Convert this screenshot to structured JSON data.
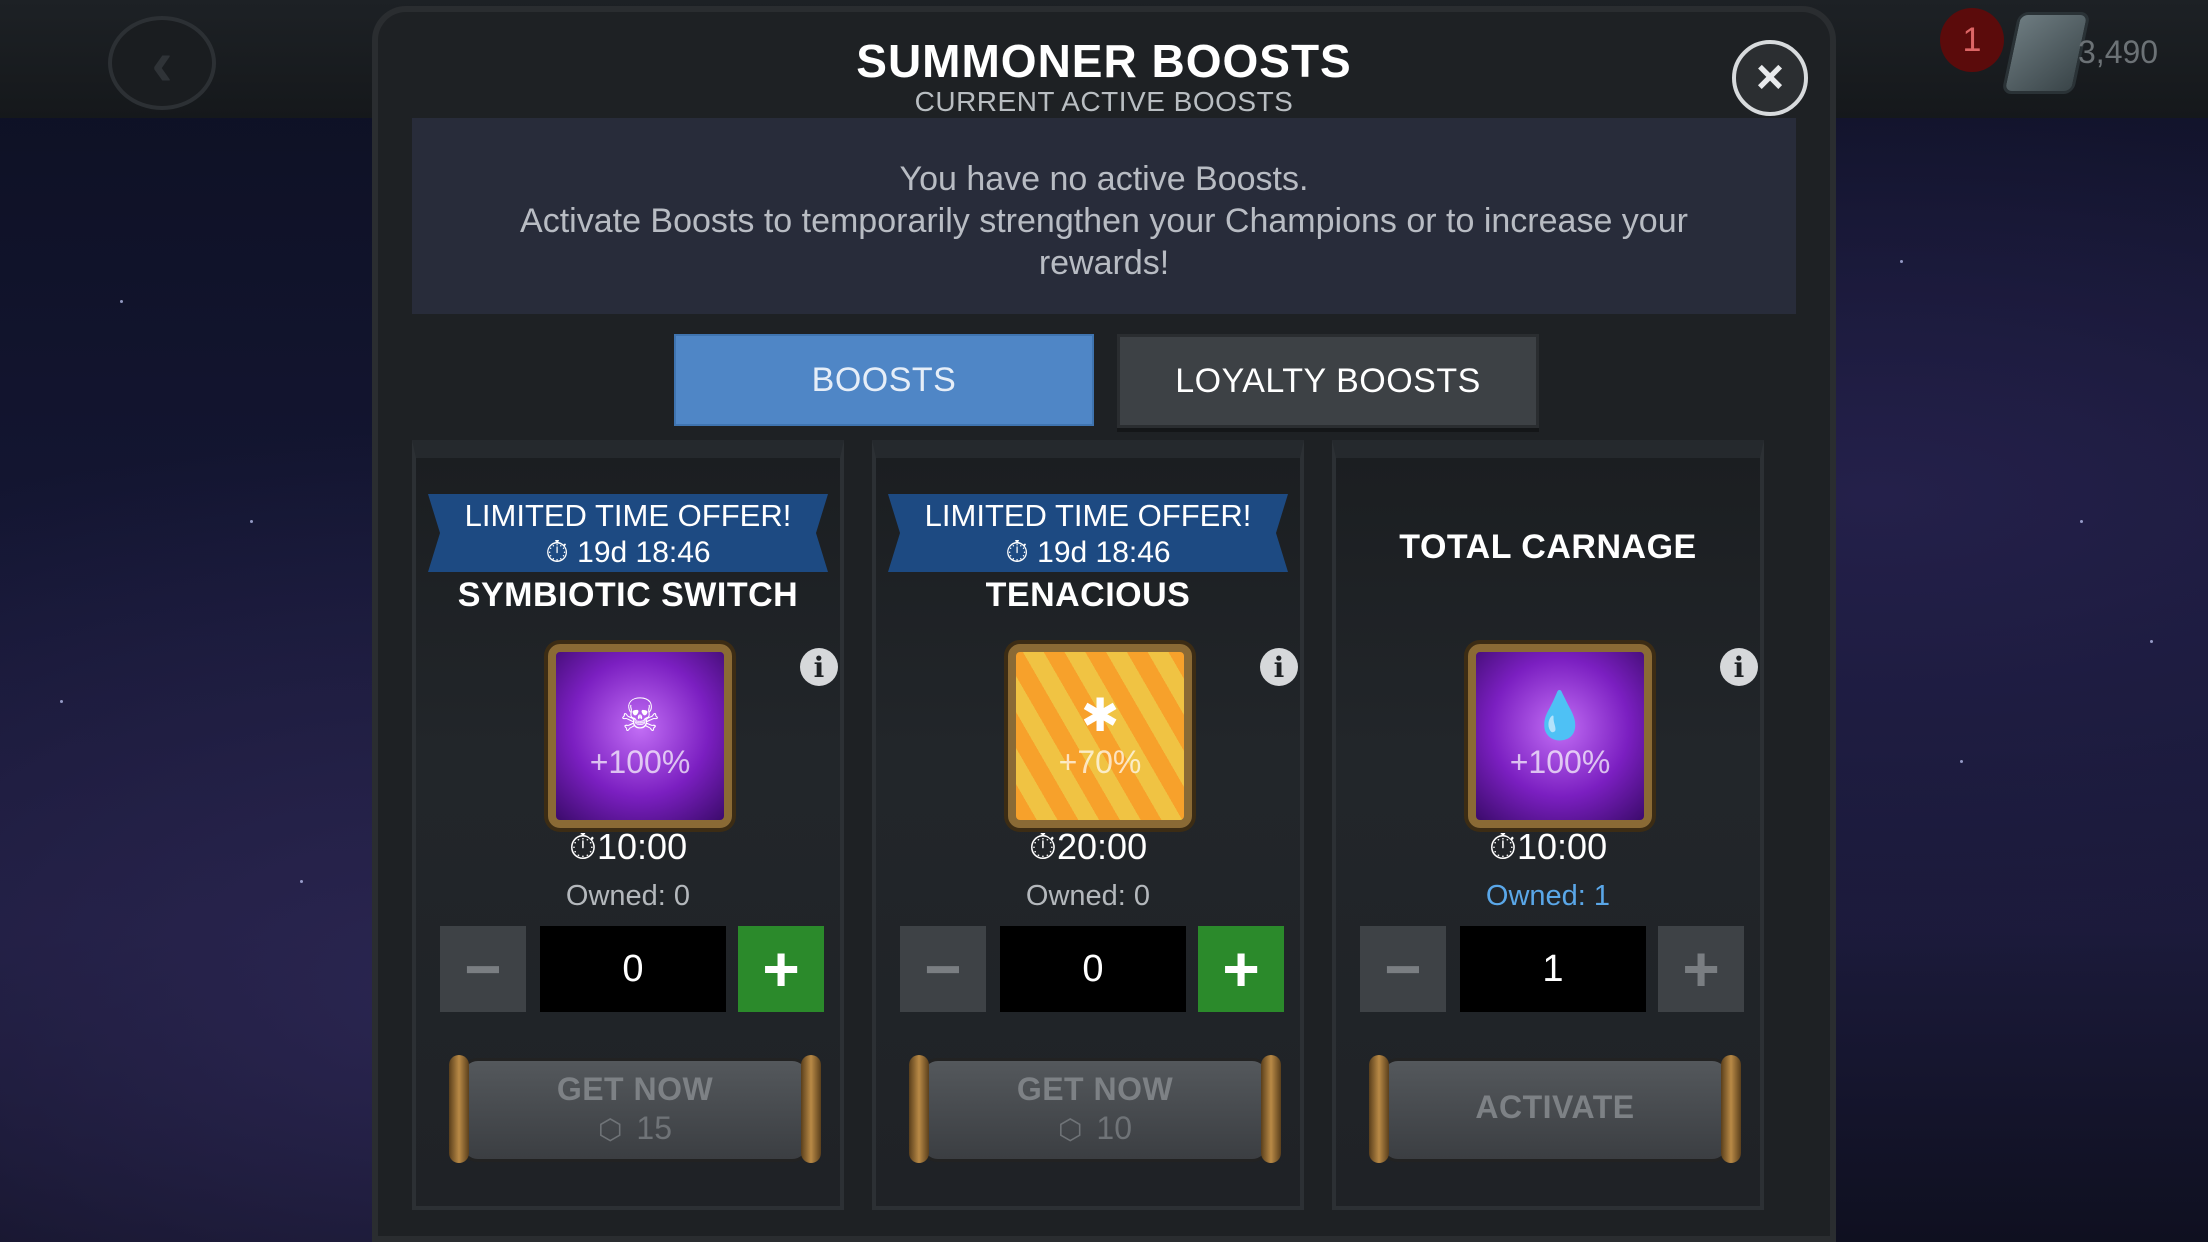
{
  "top_bar": {
    "back_icon": "back-arrow-icon",
    "notification_count": "1",
    "units_icon": "units-crystal-icon",
    "units_count": "3,490"
  },
  "modal": {
    "title": "SUMMONER BOOSTS",
    "subtitle": "CURRENT ACTIVE BOOSTS",
    "close_icon": "close-icon",
    "info_line1": "You have no active Boosts.",
    "info_line2": "Activate Boosts to temporarily strengthen your Champions or to increase your rewards!"
  },
  "tabs": [
    {
      "label": "BOOSTS",
      "active": true
    },
    {
      "label": "LOYALTY BOOSTS",
      "active": false
    }
  ],
  "cards": [
    {
      "offer_title": "LIMITED TIME OFFER!",
      "offer_timer": "19d 18:46",
      "name": "SYMBIOTIC SWITCH",
      "icon": "skull-icon",
      "percent": "+100%",
      "duration": "10:00",
      "owned": "Owned: 0",
      "quantity": "0",
      "button_label": "GET NOW",
      "button_cost": "15"
    },
    {
      "offer_title": "LIMITED TIME OFFER!",
      "offer_timer": "19d 18:46",
      "name": "TENACIOUS",
      "icon": "spider-icon",
      "percent": "+70%",
      "duration": "20:00",
      "owned": "Owned: 0",
      "quantity": "0",
      "button_label": "GET NOW",
      "button_cost": "10"
    },
    {
      "name": "TOTAL CARNAGE",
      "icon": "blood-drops-icon",
      "percent": "+100%",
      "duration": "10:00",
      "owned": "Owned: 1",
      "quantity": "1",
      "button_label": "ACTIVATE"
    }
  ],
  "colors": {
    "tab_active": "#4f86c6",
    "offer_banner": "#1d4a82",
    "plus_active": "#2b8a2b",
    "owned_highlight": "#5aa7e8"
  }
}
